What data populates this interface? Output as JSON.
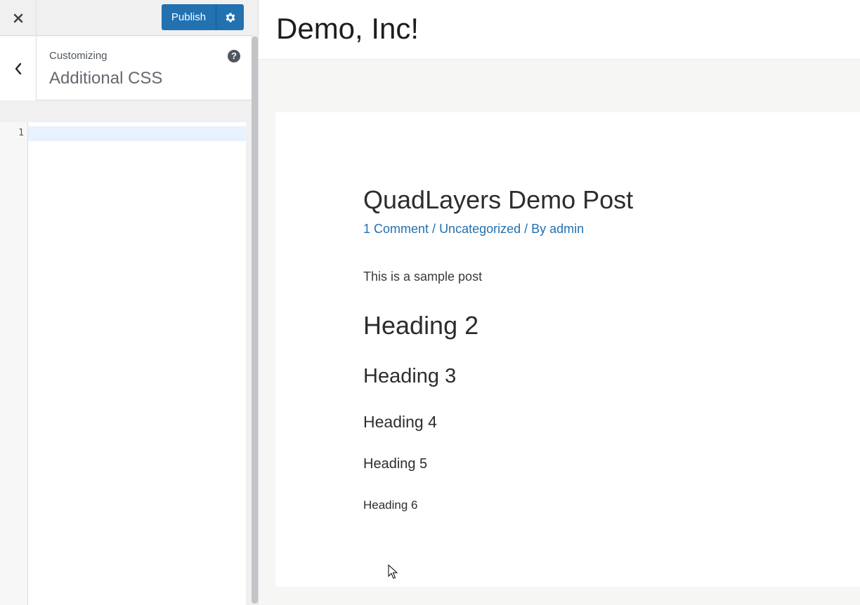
{
  "topbar": {
    "close_icon": "close-icon",
    "publish_label": "Publish",
    "settings_icon": "gear-icon"
  },
  "section": {
    "breadcrumb": "Customizing",
    "title": "Additional CSS",
    "back_icon": "chevron-left-icon",
    "help_symbol": "?"
  },
  "editor": {
    "line_number": "1",
    "value": ""
  },
  "preview": {
    "site_title": "Demo, Inc!",
    "post": {
      "title": "QuadLayers Demo Post",
      "meta": {
        "comments": "1 Comment",
        "sep1": " / ",
        "category": "Uncategorized",
        "sep2": " / By ",
        "author": "admin"
      },
      "body": "This is a sample post",
      "headings": {
        "h2": "Heading 2",
        "h3": "Heading 3",
        "h4": "Heading 4",
        "h5": "Heading 5",
        "h6": "Heading 6"
      }
    }
  },
  "colors": {
    "accent": "#2271b1",
    "sidebar_bg": "#f0f0f1",
    "active_line": "#e8f2fe"
  }
}
